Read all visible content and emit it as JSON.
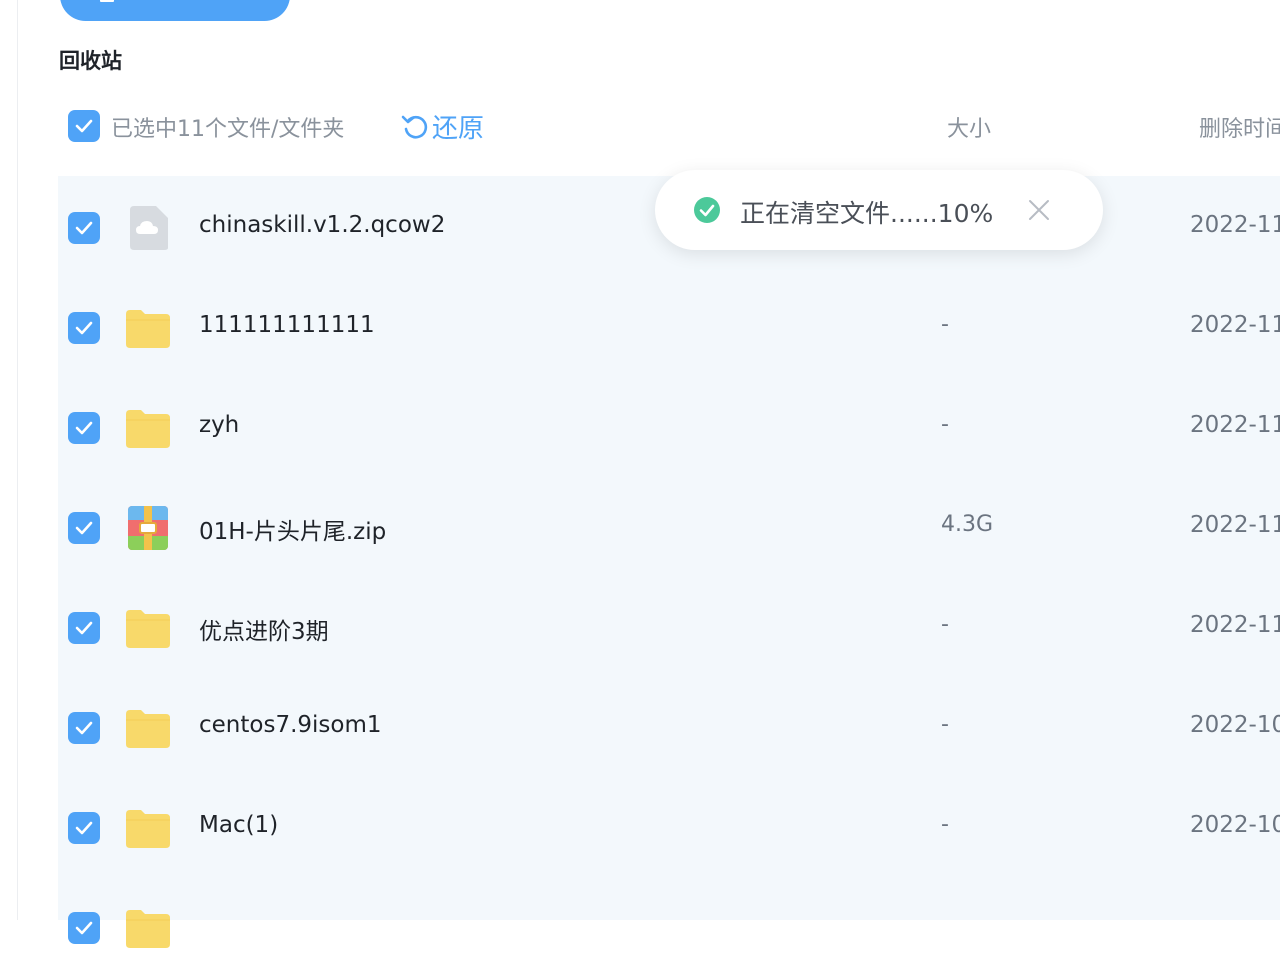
{
  "page": {
    "title": "回收站"
  },
  "toolbar": {
    "selected_text": "已选中11个文件/文件夹",
    "restore_label": "还原",
    "restore_icon": "undo-icon",
    "col_size": "大小",
    "col_deleted": "删除时间"
  },
  "toast": {
    "text": "正在清空文件......10%",
    "progress_percent": 10,
    "status_icon": "check-circle-icon",
    "close_icon": "close-icon"
  },
  "files": [
    {
      "name": "chinaskill.v1.2.qcow2",
      "size": "",
      "date": "2022-11",
      "icon": "cloud-file-icon",
      "checked": true
    },
    {
      "name": "111111111111",
      "size": "-",
      "date": "2022-11",
      "icon": "folder-icon",
      "checked": true
    },
    {
      "name": "zyh",
      "size": "-",
      "date": "2022-11",
      "icon": "folder-icon",
      "checked": true
    },
    {
      "name": "01H-片头片尾.zip",
      "size": "4.3G",
      "date": "2022-11",
      "icon": "zip-archive-icon",
      "checked": true
    },
    {
      "name": "优点进阶3期",
      "size": "-",
      "date": "2022-11",
      "icon": "folder-icon",
      "checked": true
    },
    {
      "name": "centos7.9isom1",
      "size": "-",
      "date": "2022-10",
      "icon": "folder-icon",
      "checked": true
    },
    {
      "name": "Mac(1)",
      "size": "-",
      "date": "2022-10",
      "icon": "folder-icon",
      "checked": true
    },
    {
      "name": "",
      "size": "",
      "date": "",
      "icon": "folder-icon",
      "checked": true
    }
  ],
  "colors": {
    "accent": "#4fa3f7",
    "success": "#4cc99a",
    "folder": "#f8d96a",
    "row_bg": "#f3f8fc"
  }
}
